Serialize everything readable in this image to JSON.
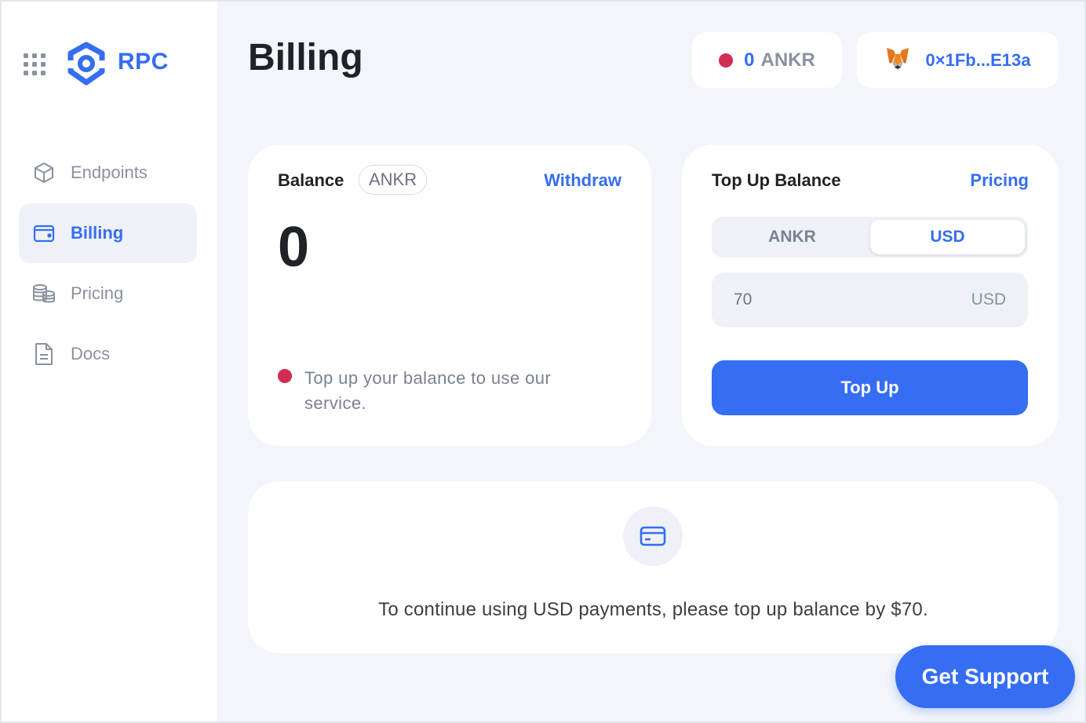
{
  "app": {
    "brand": "RPC",
    "logo_icon": "ankr-logo-icon",
    "menu_icon": "apps-grid-icon",
    "accent_color": "#356df3",
    "alert_color": "#d22c54"
  },
  "sidebar": {
    "items": [
      {
        "label": "Endpoints",
        "icon": "cube-icon",
        "active": false
      },
      {
        "label": "Billing",
        "icon": "wallet-icon",
        "active": true
      },
      {
        "label": "Pricing",
        "icon": "coins-icon",
        "active": false
      },
      {
        "label": "Docs",
        "icon": "document-icon",
        "active": false
      }
    ]
  },
  "header": {
    "title": "Billing",
    "balance_amount": "0",
    "balance_currency": "ANKR",
    "wallet_icon": "metamask-fox-icon",
    "wallet_address": "0×1Fb...E13a"
  },
  "balance_card": {
    "label": "Balance",
    "currency_tag": "ANKR",
    "withdraw_label": "Withdraw",
    "amount": "0",
    "warning": "Top up your balance to use our service."
  },
  "topup_card": {
    "label": "Top Up Balance",
    "pricing_label": "Pricing",
    "options": [
      "ANKR",
      "USD"
    ],
    "selected_option": "USD",
    "amount_placeholder": "70",
    "amount_unit": "USD",
    "button_label": "Top Up"
  },
  "notice": {
    "icon": "credit-card-icon",
    "text": "To continue using USD payments, please top up balance by $70."
  },
  "support": {
    "button_label": "Get Support"
  }
}
